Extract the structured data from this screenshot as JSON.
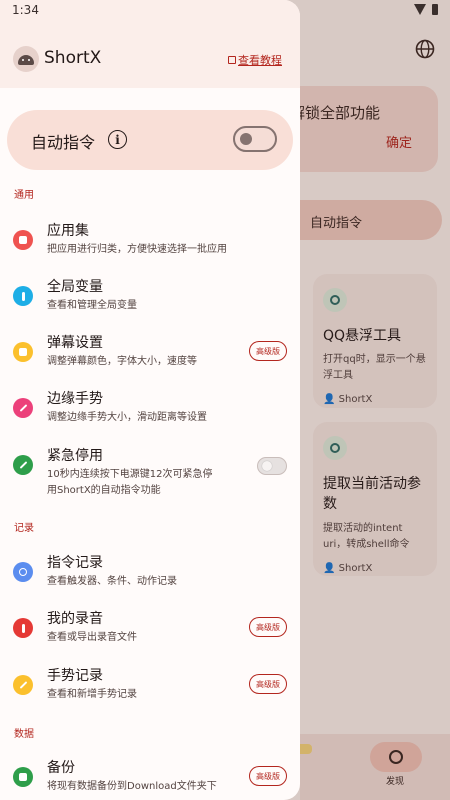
{
  "status_bar": {
    "time": "1:34"
  },
  "background": {
    "unlock_text": "解锁全部功能",
    "confirm_label": "确定",
    "auto_chip": "自动指令",
    "cards": [
      {
        "title": "QQ悬浮工具",
        "desc": "打开qq时，显示一个悬浮工具",
        "author": "ShortX"
      },
      {
        "title": "提取当前活动参数",
        "desc": "提取活动的intent uri，转成shell命令",
        "author": "ShortX"
      }
    ],
    "nav_label": "发现"
  },
  "drawer": {
    "app_title": "ShortX",
    "tutorial_link": "查看教程",
    "auto_command": {
      "label": "自动指令",
      "enabled": false
    },
    "sections": [
      {
        "title": "通用",
        "items": [
          {
            "title": "应用集",
            "desc": "把应用进行归类，方便快速选择一批应用",
            "icon": "grid-icon",
            "color": "#ef5350"
          },
          {
            "title": "全局变量",
            "desc": "查看和管理全局变量",
            "icon": "variable-icon",
            "color": "#1eaee6"
          },
          {
            "title": "弹幕设置",
            "desc": "调整弹幕颜色，字体大小，速度等",
            "icon": "message-icon",
            "color": "#fbc02d",
            "badge": "高级版"
          },
          {
            "title": "边缘手势",
            "desc": "调整边缘手势大小，滑动距离等设置",
            "icon": "gesture-icon",
            "color": "#ec407a"
          },
          {
            "title": "紧急停用",
            "desc": "10秒内连续按下电源键12次可紧急停用ShortX的自动指令功能",
            "icon": "block-icon",
            "color": "#2e9e4a",
            "toggle": false
          }
        ]
      },
      {
        "title": "记录",
        "items": [
          {
            "title": "指令记录",
            "desc": "查看触发器、条件、动作记录",
            "icon": "history-icon",
            "color": "#5b8def"
          },
          {
            "title": "我的录音",
            "desc": "查看或导出录音文件",
            "icon": "mic-icon",
            "color": "#e53935",
            "badge": "高级版"
          },
          {
            "title": "手势记录",
            "desc": "查看和新增手势记录",
            "icon": "gesture-record-icon",
            "color": "#fbc02d",
            "badge": "高级版"
          }
        ]
      },
      {
        "title": "数据",
        "items": [
          {
            "title": "备份",
            "desc": "将现有数据备份到Download文件夹下",
            "icon": "backup-icon",
            "color": "#2e9e4a",
            "badge": "高级版"
          }
        ]
      }
    ]
  }
}
